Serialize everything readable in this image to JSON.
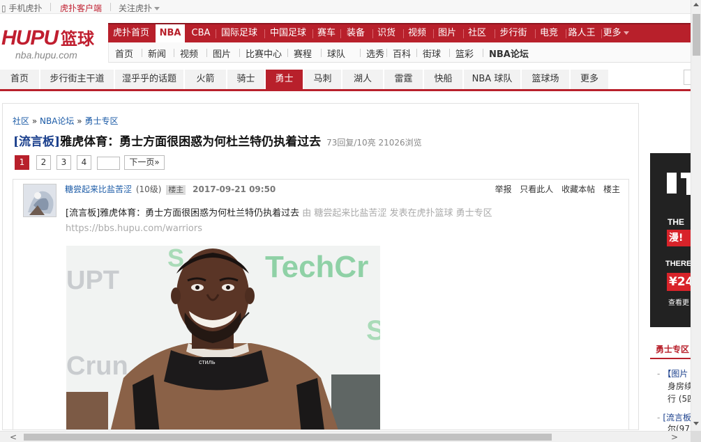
{
  "topbar": {
    "mobile": "手机虎扑",
    "client": "虎扑客户端",
    "follow": "关注虎扑"
  },
  "logo": {
    "brand": "HUPU",
    "brand_cn": "篮球",
    "domain": "nba.hupu.com"
  },
  "main_nav": [
    "虎扑首页",
    "NBA",
    "CBA",
    "国际足球",
    "中国足球",
    "赛车",
    "装备",
    "识货",
    "视频",
    "图片",
    "社区",
    "步行街",
    "电竞",
    "路人王",
    "更多"
  ],
  "main_nav_active": "NBA",
  "sub_nav": [
    "首页",
    "新闻",
    "视频",
    "图片",
    "比赛中心",
    "赛程",
    "球队",
    "选秀",
    "百科",
    "街球",
    "篮彩",
    "NBA论坛"
  ],
  "team_nav": [
    "首页",
    "步行街主干道",
    "湿乎乎的话题",
    "火箭",
    "骑士",
    "勇士",
    "马刺",
    "湖人",
    "雷霆",
    "快船",
    "NBA 球队",
    "篮球场",
    "更多"
  ],
  "team_nav_active": "勇士",
  "breadcrumb": {
    "items": [
      "社区",
      "NBA论坛",
      "勇士专区"
    ],
    "sep": "»"
  },
  "thread": {
    "tag": "[流言板]",
    "title": "雅虎体育：勇士方面很困惑为何杜兰特仍执着过去",
    "stats": "73回复/10亮 21026浏览"
  },
  "pager": {
    "pages": [
      "1",
      "2",
      "3",
      "4"
    ],
    "active": "1",
    "next": "下一页»"
  },
  "post": {
    "author": "糖尝起来比盐苦涩",
    "level": "(10级)",
    "badge": "楼主",
    "time": "2017-09-21 09:50",
    "actions": [
      "举报",
      "只看此人",
      "收藏本帖",
      "楼主"
    ],
    "body": "[流言板]雅虎体育：勇士方面很困惑为何杜兰特仍执着过去",
    "source": " 由 糖尝起来比盐苦涩 发表在虎扑篮球 勇士专区 https://bbs.hupu.com/warriors",
    "photo_bg_text_1": "TechCr",
    "photo_bg_text_2": "UPT",
    "photo_bg_text_3": "Crun",
    "photo_bg_text_4": "S",
    "photo_bg_text_5": "S",
    "jacket_text": "стиль"
  },
  "ad": {
    "the": "THE",
    "red": "漫!",
    "there": "THERE",
    "price": "¥24",
    "view": "查看更"
  },
  "rail": {
    "head": "勇士专区",
    "items": [
      {
        "title": "【图片",
        "lines": [
          "身房续",
          "行 (5四"
        ]
      },
      {
        "title": "[流言板",
        "lines": [
          "尔(97"
        ]
      }
    ]
  },
  "colors": {
    "brand_red": "#b8202b",
    "link_blue": "#1a5aa6"
  }
}
